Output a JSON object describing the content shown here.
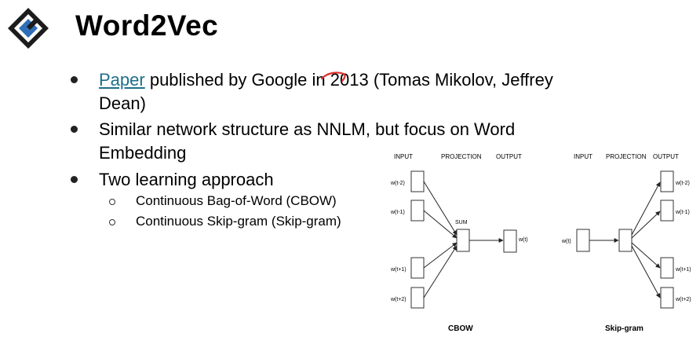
{
  "title": "Word2Vec",
  "bullets": [
    {
      "link": "Paper",
      "text": " published by Google in 2013 (Tomas Mikolov, Jeffrey",
      "cont": "Dean)"
    },
    {
      "text": "Similar network structure as NNLM, but focus on Word",
      "cont": "Embedding"
    },
    {
      "text": "Two learning approach"
    }
  ],
  "sub_bullets": [
    "Continuous Bag-of-Word (CBOW)",
    "Continuous Skip-gram (Skip-gram)"
  ],
  "diagram": {
    "cbow": {
      "headers": [
        "INPUT",
        "PROJECTION",
        "OUTPUT"
      ],
      "inputs": [
        "w(t-2)",
        "w(t-1)",
        "w(t+1)",
        "w(t+2)"
      ],
      "projection_label": "SUM",
      "output": "w(t)",
      "caption": "CBOW"
    },
    "skipgram": {
      "headers": [
        "INPUT",
        "PROJECTION",
        "OUTPUT"
      ],
      "input": "w(t)",
      "outputs": [
        "w(t-2)",
        "w(t-1)",
        "w(t+1)",
        "w(t+2)"
      ],
      "caption": "Skip-gram"
    }
  },
  "colors": {
    "link": "#1f6f8b",
    "logo_dark": "#1c1c1c",
    "logo_blue": "#2e6fb5",
    "annotation": "#e0312b"
  }
}
